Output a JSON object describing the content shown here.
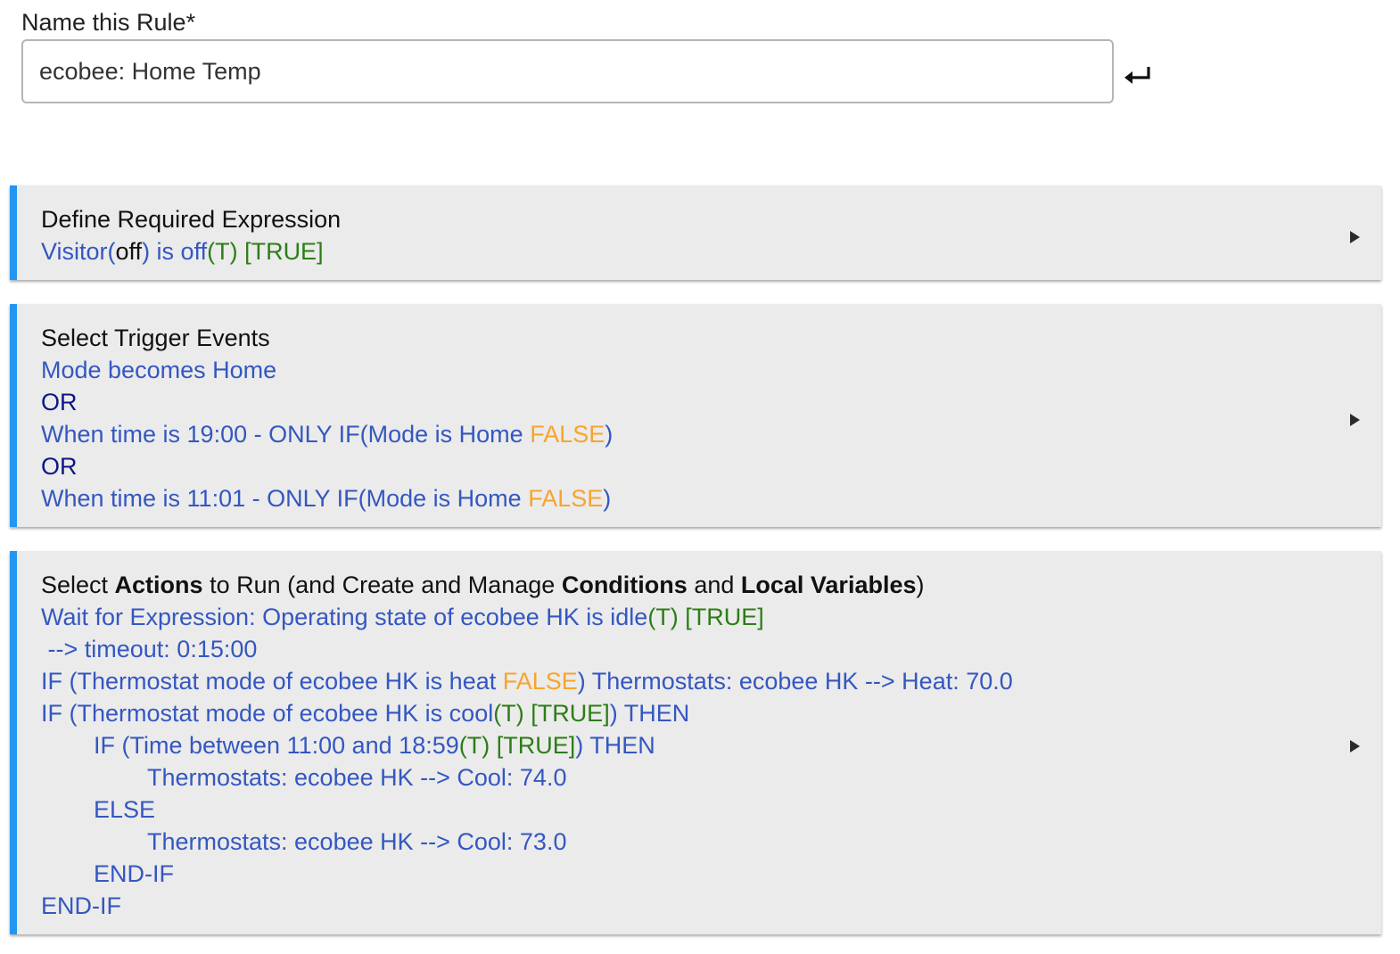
{
  "name_field": {
    "label": "Name this Rule*",
    "value": "ecobee: Home Temp"
  },
  "required_expression": {
    "title": "Define Required Expression",
    "expr_device": "Visitor(",
    "expr_state": "off",
    "expr_rest": ") is off",
    "expr_eval": "(T) [TRUE]"
  },
  "triggers": {
    "title": "Select Trigger Events",
    "t1": "Mode becomes Home",
    "or1": "OR",
    "t2_main": "When time is 19:00 - ONLY IF(Mode is Home ",
    "t2_false": "FALSE",
    "t2_close": ")",
    "or2": "OR",
    "t3_main": "When time is 11:01 - ONLY IF(Mode is Home ",
    "t3_false": "FALSE",
    "t3_close": ")"
  },
  "actions": {
    "title_select": "Select ",
    "title_actions": "Actions",
    "title_mid1": " to Run (and Create and Manage ",
    "title_conditions": "Conditions",
    "title_mid2": " and ",
    "title_locals": "Local Variables",
    "title_end": ")",
    "a1_main": "Wait for Expression: Operating state of ecobee HK is idle",
    "a1_eval": "(T) [TRUE]",
    "a2": " --> timeout: 0:15:00",
    "a3_main": "IF (Thermostat mode of ecobee HK is heat ",
    "a3_false": "FALSE",
    "a3_rest": ") Thermostats: ecobee HK --> Heat: 70.0",
    "a4_main": "IF (Thermostat mode of ecobee HK is cool",
    "a4_eval": "(T) [TRUE]",
    "a4_rest": ") THEN",
    "a5_main": "IF (Time between 11:00 and 18:59",
    "a5_eval": "(T) [TRUE]",
    "a5_rest": ") THEN",
    "a6": "Thermostats: ecobee HK --> Cool: 74.0",
    "a7": "ELSE",
    "a8": "Thermostats: ecobee HK --> Cool: 73.0",
    "a9": "END-IF",
    "a10": "END-IF"
  },
  "colors": {
    "accent": "#2196f3",
    "link": "#3457c1",
    "or": "#0d1785",
    "true": "#2c7d17",
    "false": "#f7a42c",
    "card_bg": "#ebebeb"
  }
}
